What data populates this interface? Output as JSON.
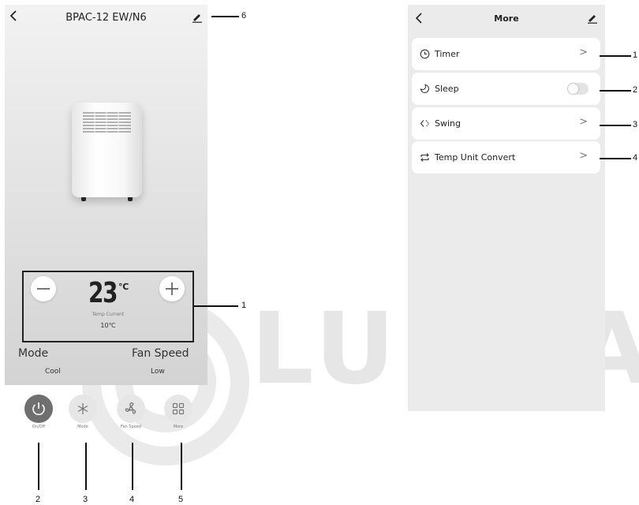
{
  "main_screen": {
    "title": "BPAC-12 EW/N6",
    "back_icon": "chevron-left-icon",
    "edit_icon": "pencil-icon",
    "temperature": {
      "value": "23",
      "unit": "℃",
      "caption": "Temp Current",
      "current": "10℃"
    },
    "mode": {
      "label": "Mode",
      "value": "Cool"
    },
    "fan_speed": {
      "label": "Fan Speed",
      "value": "Low"
    },
    "controls": [
      {
        "label": "On/Off",
        "icon": "power-icon"
      },
      {
        "label": "Mode",
        "icon": "snowflake-icon"
      },
      {
        "label": "Fan Speed",
        "icon": "fan-icon"
      },
      {
        "label": "More",
        "icon": "grid-icon"
      }
    ]
  },
  "more_screen": {
    "title": "More",
    "items": [
      {
        "label": "Timer",
        "icon": "clock-icon",
        "control": "chevron"
      },
      {
        "label": "Sleep",
        "icon": "moon-icon",
        "control": "toggle",
        "toggle_on": false
      },
      {
        "label": "Swing",
        "icon": "swing-icon",
        "control": "chevron"
      },
      {
        "label": "Temp Unit Convert",
        "icon": "convert-icon",
        "control": "chevron"
      }
    ]
  },
  "callouts": {
    "main": [
      "1",
      "2",
      "3",
      "4",
      "5",
      "6"
    ],
    "more": [
      "1",
      "2",
      "3",
      "4"
    ]
  },
  "watermark": "LUNDA",
  "colors": {
    "power_button": "#6f6f6f",
    "control_button": "#e6e6e6",
    "more_background": "#ebebeb"
  }
}
